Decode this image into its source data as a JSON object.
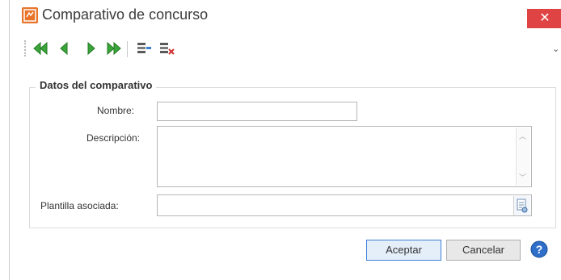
{
  "window": {
    "title": "Comparativo de concurso",
    "close_glyph": "✕"
  },
  "toolbar": {
    "items": [
      {
        "name": "first-record-icon",
        "color": "#2f9e2f"
      },
      {
        "name": "previous-record-icon",
        "color": "#2f9e2f"
      },
      {
        "name": "next-record-icon",
        "color": "#2f9e2f"
      },
      {
        "name": "last-record-icon",
        "color": "#2f9e2f"
      },
      {
        "name": "edit-properties-icon"
      },
      {
        "name": "delete-properties-icon",
        "color": "#d23030"
      }
    ],
    "overflow_glyph": "⌄"
  },
  "group": {
    "title": "Datos del comparativo"
  },
  "fields": {
    "nombre": {
      "label": "Nombre:",
      "value": ""
    },
    "descripcion": {
      "label": "Descripción:",
      "value": ""
    },
    "plantilla": {
      "label": "Plantilla asociada:",
      "value": ""
    }
  },
  "buttons": {
    "accept": "Aceptar",
    "cancel": "Cancelar",
    "help_icon": "help-icon"
  },
  "colors": {
    "accent": "#3c7fd4",
    "close": "#e04343",
    "nav": "#2f9e2f"
  }
}
